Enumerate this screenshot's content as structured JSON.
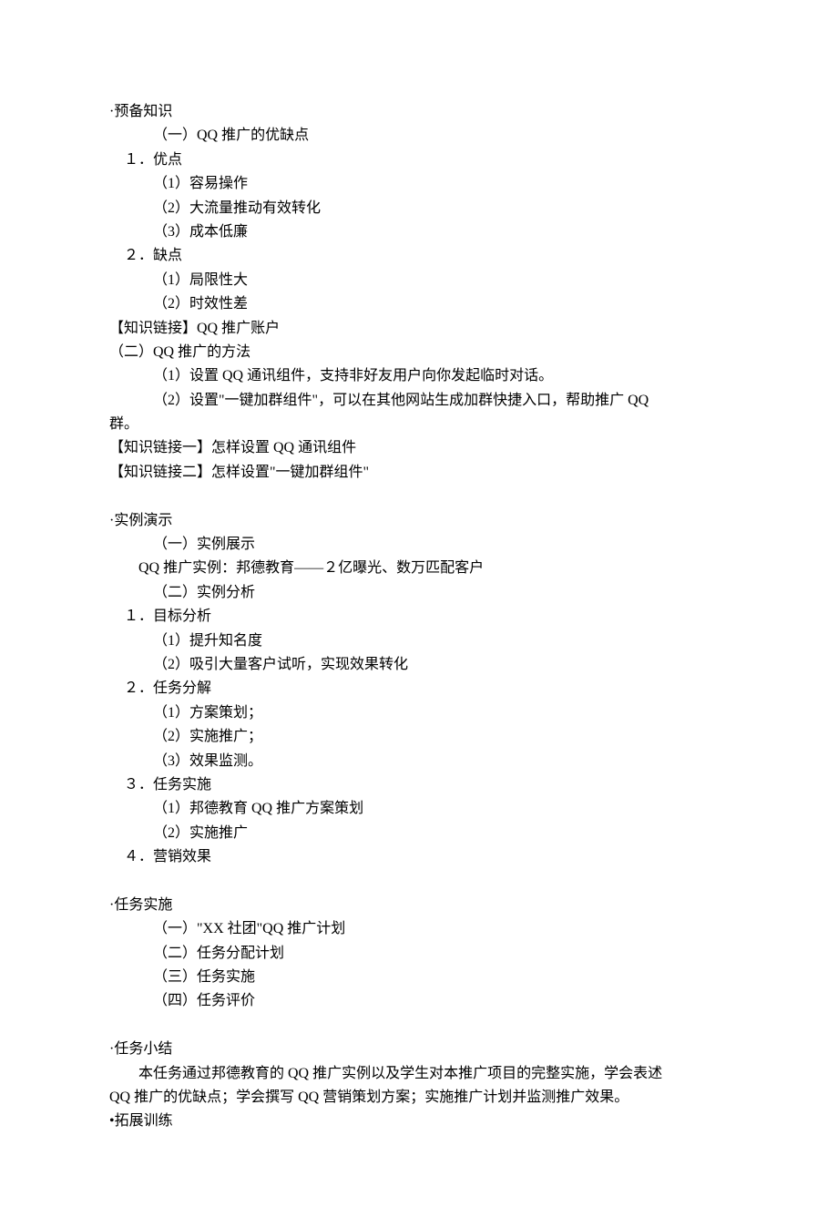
{
  "sections": {
    "prep": {
      "heading": "·预备知识",
      "sub1_title": "（一）QQ 推广的优缺点",
      "advantages": {
        "title": "１．优点",
        "items": [
          "（1）容易操作",
          "（2）大流量推动有效转化",
          "（3）成本低廉"
        ]
      },
      "disadvantages": {
        "title": "２．缺点",
        "items": [
          "（1）局限性大",
          "（2）时效性差"
        ]
      },
      "link1": "【知识链接】QQ 推广账户",
      "sub2_title": "（二）QQ 推广的方法",
      "method1": "（1）设置 QQ 通讯组件，支持非好友用户向你发起临时对话。",
      "method2_line1": "（2）设置\"一键加群组件\"，可以在其他网站生成加群快捷入口，帮助推广 QQ",
      "method2_line2": "群。",
      "link2": "【知识链接一】怎样设置 QQ 通讯组件",
      "link3": "【知识链接二】怎样设置\"一键加群组件\""
    },
    "demo": {
      "heading": "·实例演示",
      "show_title": "（一）实例展示",
      "case": "QQ 推广实例：邦德教育——２亿曝光、数万匹配客户",
      "analysis_title": "（二）实例分析",
      "goal": {
        "title": "１．目标分析",
        "items": [
          "（1）提升知名度",
          "（2）吸引大量客户试听，实现效果转化"
        ]
      },
      "decompose": {
        "title": "２．任务分解",
        "items": [
          "（1）方案策划；",
          "（2）实施推广；",
          "（3）效果监测。"
        ]
      },
      "execute": {
        "title": "３．任务实施",
        "items": [
          "（1）邦德教育 QQ 推广方案策划",
          "（2）实施推广"
        ]
      },
      "effect_title": "４．营销效果"
    },
    "task": {
      "heading": "·任务实施",
      "items": [
        "（一）\"XX 社团\"QQ 推广计划",
        "（二）任务分配计划",
        "（三）任务实施",
        "（四）任务评价"
      ]
    },
    "summary": {
      "heading": "·任务小结",
      "line1": "本任务通过邦德教育的 QQ 推广实例以及学生对本推广项目的完整实施，学会表述",
      "line2": "QQ 推广的优缺点；学会撰写 QQ 营销策划方案；实施推广计划并监测推广效果。"
    },
    "extend": {
      "heading": "•拓展训练"
    }
  }
}
